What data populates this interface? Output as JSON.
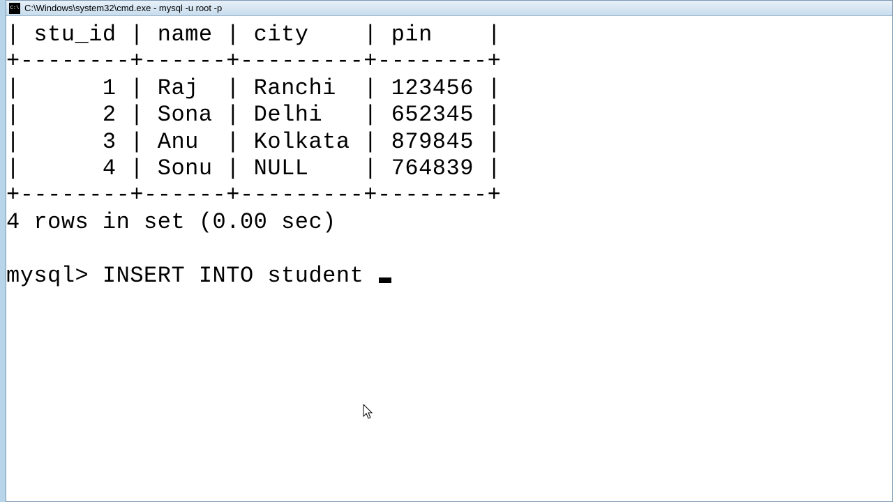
{
  "window": {
    "title": "C:\\Windows\\system32\\cmd.exe - mysql  -u root -p"
  },
  "table": {
    "headers": {
      "col1": "stu_id",
      "col2": "name",
      "col3": "city",
      "col4": "pin"
    },
    "rows": [
      {
        "stu_id": "1",
        "name": "Raj",
        "city": "Ranchi",
        "pin": "123456"
      },
      {
        "stu_id": "2",
        "name": "Sona",
        "city": "Delhi",
        "pin": "652345"
      },
      {
        "stu_id": "3",
        "name": "Anu",
        "city": "Kolkata",
        "pin": "879845"
      },
      {
        "stu_id": "4",
        "name": "Sonu",
        "city": "NULL",
        "pin": "764839"
      }
    ],
    "border_line": "+--------+------+---------+--------+"
  },
  "status": {
    "rows_text": "4 rows in set (0.00 sec)"
  },
  "prompt": {
    "label": "mysql>",
    "command": "INSERT INTO student"
  },
  "chart_data": {
    "type": "table",
    "title": "student",
    "columns": [
      "stu_id",
      "name",
      "city",
      "pin"
    ],
    "rows": [
      [
        1,
        "Raj",
        "Ranchi",
        123456
      ],
      [
        2,
        "Sona",
        "Delhi",
        652345
      ],
      [
        3,
        "Anu",
        "Kolkata",
        879845
      ],
      [
        4,
        "Sonu",
        null,
        764839
      ]
    ]
  }
}
